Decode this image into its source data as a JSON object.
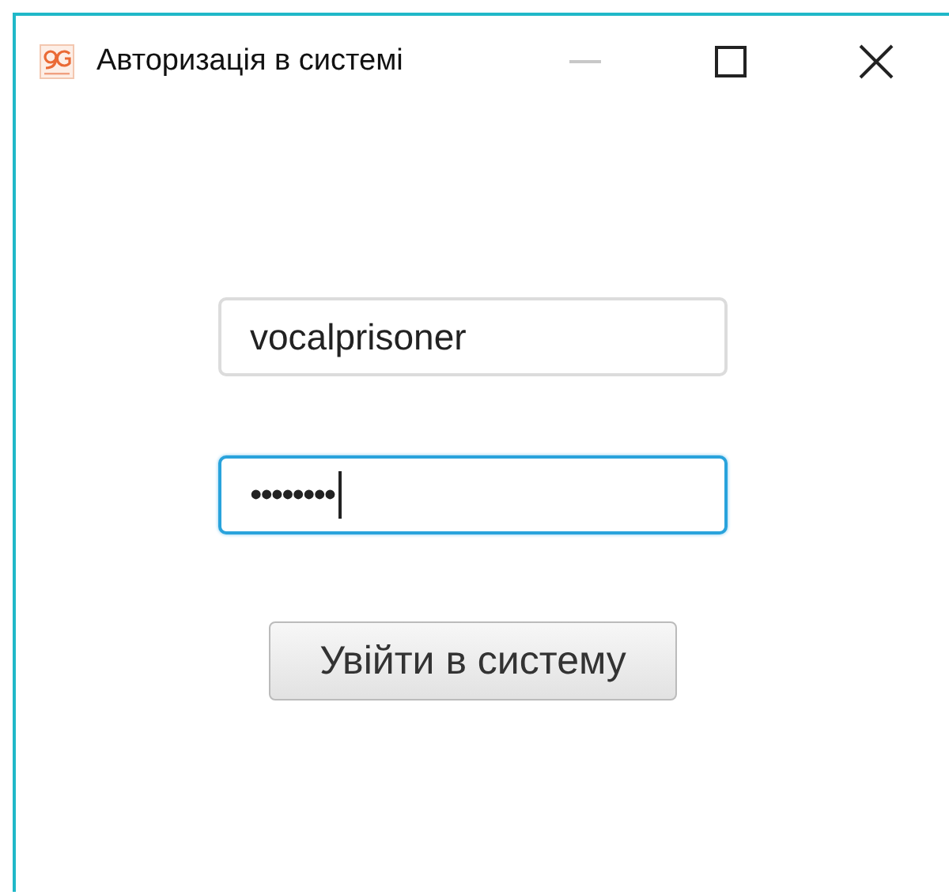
{
  "window": {
    "title": "Авторизація в системі",
    "controls": [
      {
        "kind": "minimize",
        "disabled": true
      },
      {
        "kind": "maximize",
        "disabled": false
      },
      {
        "kind": "close",
        "disabled": false
      }
    ]
  },
  "fields": [
    {
      "kind": "text",
      "value": "vocalprisoner",
      "focused": false
    },
    {
      "kind": "password",
      "value": "••••••••",
      "focused": true
    }
  ],
  "button": {
    "label": "Увійти в систему"
  }
}
